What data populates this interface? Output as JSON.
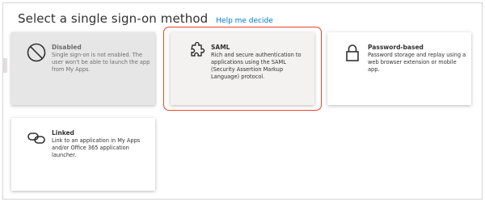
{
  "header": {
    "title": "Select a single sign-on method",
    "help_link": "Help me decide"
  },
  "methods": [
    {
      "name": "Disabled",
      "description": "Single sign-on is not enabled. The user won't be able to launch the app from My Apps.",
      "icon": "disabled-icon",
      "state": "disabled"
    },
    {
      "name": "SAML",
      "description": "Rich and secure authentication to applications using the SAML (Security Assertion Markup Language) protocol.",
      "icon": "puzzle-icon",
      "state": "selected"
    },
    {
      "name": "Password-based",
      "description": "Password storage and replay using a web browser extension or mobile app.",
      "icon": "lock-icon",
      "state": "normal"
    },
    {
      "name": "Linked",
      "description": "Link to an application in My Apps and/or Office 365 application launcher.",
      "icon": "link-icon",
      "state": "normal"
    }
  ],
  "colors": {
    "accent_link": "#0078d4",
    "selection_ring": "#e8432b",
    "text": "#323130"
  }
}
